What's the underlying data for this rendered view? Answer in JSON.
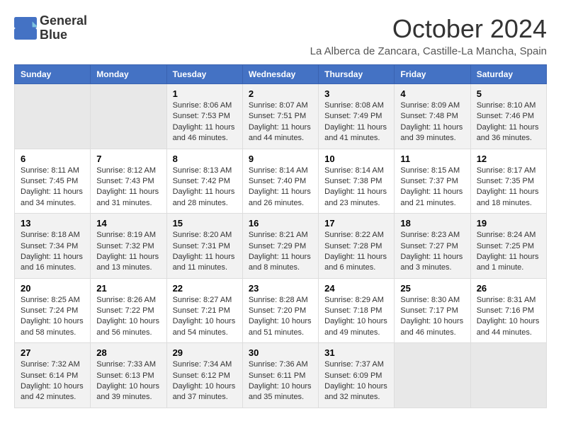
{
  "logo": {
    "line1": "General",
    "line2": "Blue"
  },
  "title": "October 2024",
  "subtitle": "La Alberca de Zancara, Castille-La Mancha, Spain",
  "days_of_week": [
    "Sunday",
    "Monday",
    "Tuesday",
    "Wednesday",
    "Thursday",
    "Friday",
    "Saturday"
  ],
  "weeks": [
    [
      {
        "day": "",
        "sunrise": "",
        "sunset": "",
        "daylight": "",
        "empty": true
      },
      {
        "day": "",
        "sunrise": "",
        "sunset": "",
        "daylight": "",
        "empty": true
      },
      {
        "day": "1",
        "sunrise": "Sunrise: 8:06 AM",
        "sunset": "Sunset: 7:53 PM",
        "daylight": "Daylight: 11 hours and 46 minutes.",
        "empty": false
      },
      {
        "day": "2",
        "sunrise": "Sunrise: 8:07 AM",
        "sunset": "Sunset: 7:51 PM",
        "daylight": "Daylight: 11 hours and 44 minutes.",
        "empty": false
      },
      {
        "day": "3",
        "sunrise": "Sunrise: 8:08 AM",
        "sunset": "Sunset: 7:49 PM",
        "daylight": "Daylight: 11 hours and 41 minutes.",
        "empty": false
      },
      {
        "day": "4",
        "sunrise": "Sunrise: 8:09 AM",
        "sunset": "Sunset: 7:48 PM",
        "daylight": "Daylight: 11 hours and 39 minutes.",
        "empty": false
      },
      {
        "day": "5",
        "sunrise": "Sunrise: 8:10 AM",
        "sunset": "Sunset: 7:46 PM",
        "daylight": "Daylight: 11 hours and 36 minutes.",
        "empty": false
      }
    ],
    [
      {
        "day": "6",
        "sunrise": "Sunrise: 8:11 AM",
        "sunset": "Sunset: 7:45 PM",
        "daylight": "Daylight: 11 hours and 34 minutes.",
        "empty": false
      },
      {
        "day": "7",
        "sunrise": "Sunrise: 8:12 AM",
        "sunset": "Sunset: 7:43 PM",
        "daylight": "Daylight: 11 hours and 31 minutes.",
        "empty": false
      },
      {
        "day": "8",
        "sunrise": "Sunrise: 8:13 AM",
        "sunset": "Sunset: 7:42 PM",
        "daylight": "Daylight: 11 hours and 28 minutes.",
        "empty": false
      },
      {
        "day": "9",
        "sunrise": "Sunrise: 8:14 AM",
        "sunset": "Sunset: 7:40 PM",
        "daylight": "Daylight: 11 hours and 26 minutes.",
        "empty": false
      },
      {
        "day": "10",
        "sunrise": "Sunrise: 8:14 AM",
        "sunset": "Sunset: 7:38 PM",
        "daylight": "Daylight: 11 hours and 23 minutes.",
        "empty": false
      },
      {
        "day": "11",
        "sunrise": "Sunrise: 8:15 AM",
        "sunset": "Sunset: 7:37 PM",
        "daylight": "Daylight: 11 hours and 21 minutes.",
        "empty": false
      },
      {
        "day": "12",
        "sunrise": "Sunrise: 8:17 AM",
        "sunset": "Sunset: 7:35 PM",
        "daylight": "Daylight: 11 hours and 18 minutes.",
        "empty": false
      }
    ],
    [
      {
        "day": "13",
        "sunrise": "Sunrise: 8:18 AM",
        "sunset": "Sunset: 7:34 PM",
        "daylight": "Daylight: 11 hours and 16 minutes.",
        "empty": false
      },
      {
        "day": "14",
        "sunrise": "Sunrise: 8:19 AM",
        "sunset": "Sunset: 7:32 PM",
        "daylight": "Daylight: 11 hours and 13 minutes.",
        "empty": false
      },
      {
        "day": "15",
        "sunrise": "Sunrise: 8:20 AM",
        "sunset": "Sunset: 7:31 PM",
        "daylight": "Daylight: 11 hours and 11 minutes.",
        "empty": false
      },
      {
        "day": "16",
        "sunrise": "Sunrise: 8:21 AM",
        "sunset": "Sunset: 7:29 PM",
        "daylight": "Daylight: 11 hours and 8 minutes.",
        "empty": false
      },
      {
        "day": "17",
        "sunrise": "Sunrise: 8:22 AM",
        "sunset": "Sunset: 7:28 PM",
        "daylight": "Daylight: 11 hours and 6 minutes.",
        "empty": false
      },
      {
        "day": "18",
        "sunrise": "Sunrise: 8:23 AM",
        "sunset": "Sunset: 7:27 PM",
        "daylight": "Daylight: 11 hours and 3 minutes.",
        "empty": false
      },
      {
        "day": "19",
        "sunrise": "Sunrise: 8:24 AM",
        "sunset": "Sunset: 7:25 PM",
        "daylight": "Daylight: 11 hours and 1 minute.",
        "empty": false
      }
    ],
    [
      {
        "day": "20",
        "sunrise": "Sunrise: 8:25 AM",
        "sunset": "Sunset: 7:24 PM",
        "daylight": "Daylight: 10 hours and 58 minutes.",
        "empty": false
      },
      {
        "day": "21",
        "sunrise": "Sunrise: 8:26 AM",
        "sunset": "Sunset: 7:22 PM",
        "daylight": "Daylight: 10 hours and 56 minutes.",
        "empty": false
      },
      {
        "day": "22",
        "sunrise": "Sunrise: 8:27 AM",
        "sunset": "Sunset: 7:21 PM",
        "daylight": "Daylight: 10 hours and 54 minutes.",
        "empty": false
      },
      {
        "day": "23",
        "sunrise": "Sunrise: 8:28 AM",
        "sunset": "Sunset: 7:20 PM",
        "daylight": "Daylight: 10 hours and 51 minutes.",
        "empty": false
      },
      {
        "day": "24",
        "sunrise": "Sunrise: 8:29 AM",
        "sunset": "Sunset: 7:18 PM",
        "daylight": "Daylight: 10 hours and 49 minutes.",
        "empty": false
      },
      {
        "day": "25",
        "sunrise": "Sunrise: 8:30 AM",
        "sunset": "Sunset: 7:17 PM",
        "daylight": "Daylight: 10 hours and 46 minutes.",
        "empty": false
      },
      {
        "day": "26",
        "sunrise": "Sunrise: 8:31 AM",
        "sunset": "Sunset: 7:16 PM",
        "daylight": "Daylight: 10 hours and 44 minutes.",
        "empty": false
      }
    ],
    [
      {
        "day": "27",
        "sunrise": "Sunrise: 7:32 AM",
        "sunset": "Sunset: 6:14 PM",
        "daylight": "Daylight: 10 hours and 42 minutes.",
        "empty": false
      },
      {
        "day": "28",
        "sunrise": "Sunrise: 7:33 AM",
        "sunset": "Sunset: 6:13 PM",
        "daylight": "Daylight: 10 hours and 39 minutes.",
        "empty": false
      },
      {
        "day": "29",
        "sunrise": "Sunrise: 7:34 AM",
        "sunset": "Sunset: 6:12 PM",
        "daylight": "Daylight: 10 hours and 37 minutes.",
        "empty": false
      },
      {
        "day": "30",
        "sunrise": "Sunrise: 7:36 AM",
        "sunset": "Sunset: 6:11 PM",
        "daylight": "Daylight: 10 hours and 35 minutes.",
        "empty": false
      },
      {
        "day": "31",
        "sunrise": "Sunrise: 7:37 AM",
        "sunset": "Sunset: 6:09 PM",
        "daylight": "Daylight: 10 hours and 32 minutes.",
        "empty": false
      },
      {
        "day": "",
        "sunrise": "",
        "sunset": "",
        "daylight": "",
        "empty": true
      },
      {
        "day": "",
        "sunrise": "",
        "sunset": "",
        "daylight": "",
        "empty": true
      }
    ]
  ]
}
